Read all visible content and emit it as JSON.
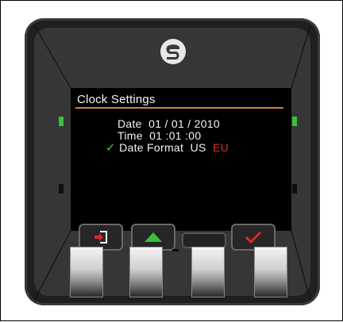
{
  "screen": {
    "title": "Clock Settings",
    "date_line": "Date  01 / 01 / 2010",
    "time_line": "Time  01 :01 :00",
    "format_label": "Date Format",
    "format_us": "US",
    "format_eu": "EU",
    "selected_format": "US",
    "check_glyph": "✓"
  },
  "colors": {
    "screen_text": "#f4f4f4",
    "title_rule": "#d08030",
    "checkmark": "#44cc44",
    "eu_text": "#e0282a",
    "led": "#3ac03a"
  },
  "keys": [
    {
      "id": "exit",
      "icon": "exit-icon"
    },
    {
      "id": "up",
      "icon": "up-arrow-icon"
    },
    {
      "id": "blank",
      "icon": "none"
    },
    {
      "id": "confirm",
      "icon": "check-icon"
    }
  ]
}
